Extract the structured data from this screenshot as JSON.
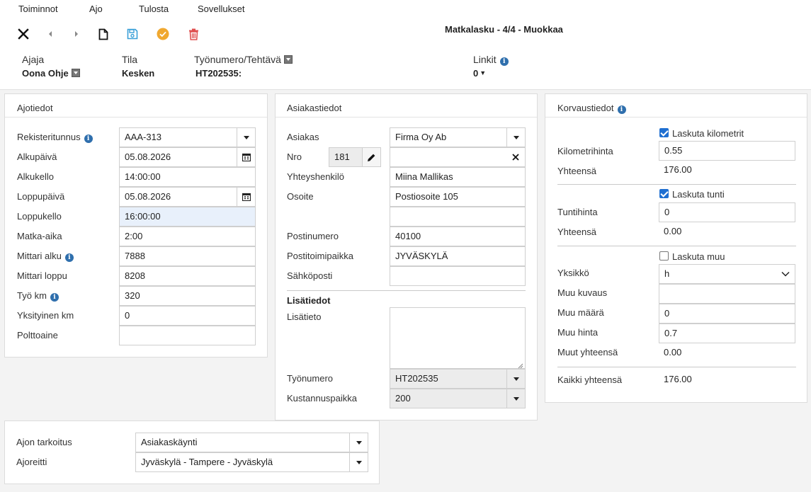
{
  "menu": [
    "Toiminnot",
    "Ajo",
    "Tulosta",
    "Sovellukset"
  ],
  "toolbar": {
    "close_icon": "close-icon",
    "prev_icon": "prev-icon",
    "next_icon": "next-icon",
    "new_icon": "new-document-icon",
    "save_icon": "save-icon",
    "approve_icon": "check-circle-icon",
    "delete_icon": "trash-icon",
    "colors": {
      "save": "#3aa0d8",
      "approve": "#f0a830",
      "delete": "#e05050"
    }
  },
  "title": "Matkalasku - 4/4 - Muokkaa",
  "header": {
    "driver_label": "Ajaja",
    "driver_value": "Oona Ohje",
    "state_label": "Tila",
    "state_value": "Kesken",
    "job_label": "Työnumero/Tehtävä",
    "job_value": "HT202535:",
    "links_label": "Linkit",
    "links_value": "0"
  },
  "ajotiedot": {
    "title": "Ajotiedot",
    "fields": {
      "reg": {
        "label": "Rekisteritunnus",
        "value": "AAA-313"
      },
      "start_date": {
        "label": "Alkupäivä",
        "value": "05.08.2026"
      },
      "start_time": {
        "label": "Alkukello",
        "value": "14:00:00"
      },
      "end_date": {
        "label": "Loppupäivä",
        "value": "05.08.2026"
      },
      "end_time": {
        "label": "Loppukello",
        "value": "16:00:00"
      },
      "duration": {
        "label": "Matka-aika",
        "value": "2:00"
      },
      "meter_start": {
        "label": "Mittari alku",
        "value": "7888"
      },
      "meter_end": {
        "label": "Mittari loppu",
        "value": "8208"
      },
      "work_km": {
        "label": "Työ km",
        "value": "320"
      },
      "private_km": {
        "label": "Yksityinen km",
        "value": "0"
      },
      "fuel": {
        "label": "Polttoaine",
        "value": ""
      }
    }
  },
  "asiakastiedot": {
    "title": "Asiakastiedot",
    "customer": {
      "label": "Asiakas",
      "value": "Firma Oy Ab"
    },
    "number": {
      "label": "Nro",
      "value": "181",
      "value2": ""
    },
    "contact": {
      "label": "Yhteyshenkilö",
      "value": "Miina Mallikas"
    },
    "address": {
      "label": "Osoite",
      "value": "Postiosoite 105",
      "value2": ""
    },
    "postal": {
      "label": "Postinumero",
      "value": "40100"
    },
    "city": {
      "label": "Postitoimipaikka",
      "value": "JYVÄSKYLÄ"
    },
    "email": {
      "label": "Sähköposti",
      "value": ""
    },
    "extra_title": "Lisätiedot",
    "extra": {
      "label": "Lisätieto",
      "value": ""
    },
    "job": {
      "label": "Työnumero",
      "value": "HT202535"
    },
    "cost_center": {
      "label": "Kustannuspaikka",
      "value": "200"
    }
  },
  "korvaustiedot": {
    "title": "Korvaustiedot",
    "km_check": {
      "label": "Laskuta kilometrit",
      "checked": true
    },
    "km_price": {
      "label": "Kilometrihinta",
      "value": "0.55"
    },
    "km_total": {
      "label": "Yhteensä",
      "value": "176.00"
    },
    "hour_check": {
      "label": "Laskuta tunti",
      "checked": true
    },
    "hour_price": {
      "label": "Tuntihinta",
      "value": "0"
    },
    "hour_total": {
      "label": "Yhteensä",
      "value": "0.00"
    },
    "other_check": {
      "label": "Laskuta muu",
      "checked": false
    },
    "unit": {
      "label": "Yksikkö",
      "value": "h"
    },
    "other_desc": {
      "label": "Muu kuvaus",
      "value": ""
    },
    "other_qty": {
      "label": "Muu määrä",
      "value": "0"
    },
    "other_price": {
      "label": "Muu hinta",
      "value": "0.7"
    },
    "other_total": {
      "label": "Muut yhteensä",
      "value": "0.00"
    },
    "grand_total": {
      "label": "Kaikki yhteensä",
      "value": "176.00"
    }
  },
  "purpose": {
    "purpose": {
      "label": "Ajon tarkoitus",
      "value": "Asiakaskäynti"
    },
    "route": {
      "label": "Ajoreitti",
      "value": "Jyväskylä - Tampere - Jyväskylä"
    }
  }
}
